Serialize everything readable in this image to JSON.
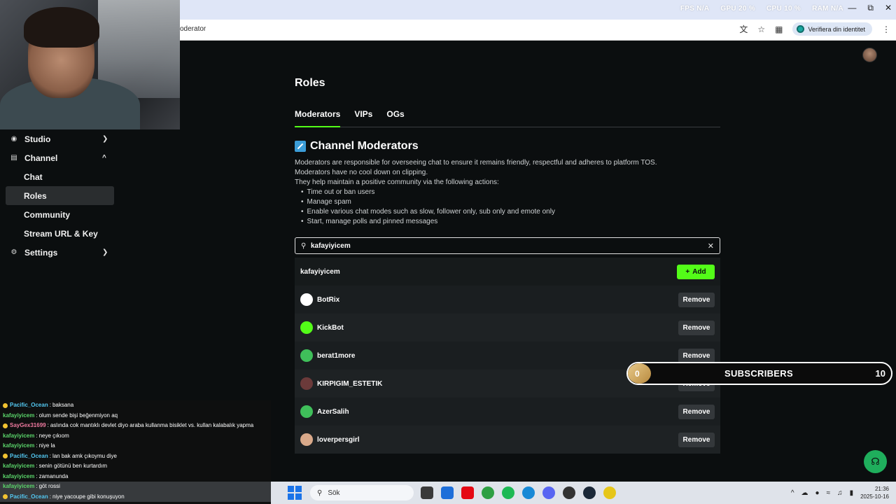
{
  "browser": {
    "url_fragment": "oderator",
    "verify_label": "Verifiera din identitet",
    "overlay_stats": [
      "FPS N/A",
      "GPU 20 %",
      "CPU 10 %",
      "RAM N/A"
    ]
  },
  "sidebar": {
    "studio": "Studio",
    "channel": "Channel",
    "channel_items": [
      "Chat",
      "Roles",
      "Community",
      "Stream URL & Key"
    ],
    "settings": "Settings"
  },
  "page": {
    "title": "Roles",
    "tabs": [
      "Moderators",
      "VIPs",
      "OGs"
    ],
    "section_title": "Channel Moderators",
    "desc_lines": [
      "Moderators are responsible for overseeing chat to ensure it remains friendly, respectful and adheres to platform TOS.",
      "Moderators have no cool down on clipping.",
      "They help maintain a positive community via the following actions:"
    ],
    "bullets": [
      "Time out or ban users",
      "Manage spam",
      "Enable various chat modes such as slow, follower only, sub only and emote only",
      "Start, manage polls and pinned messages"
    ],
    "search_value": "kafayiyicem",
    "search_result": "kafayiyicem",
    "add_label": "Add",
    "remove_label": "Remove",
    "moderators": [
      {
        "name": "BotRix",
        "color": "#ffffff"
      },
      {
        "name": "KickBot",
        "color": "#53fc18"
      },
      {
        "name": "berat1more",
        "color": "#3fbf5a"
      },
      {
        "name": "KIRPIGIM_ESTETIK",
        "color": "#6b3a3a"
      },
      {
        "name": "AzerSalih",
        "color": "#3fbf5a"
      },
      {
        "name": "loverpersgirl",
        "color": "#d9a98a"
      }
    ]
  },
  "subscribers_widget": {
    "progress": "0",
    "label": "SUBSCRIBERS",
    "count": "10"
  },
  "chat": [
    {
      "user": "Pacific_Ocean",
      "text": "baksana",
      "badge": true,
      "color": "#53c7f0"
    },
    {
      "user": "kafayiyicem",
      "text": "olum sende bişi beğenmiyon aq",
      "badge": false,
      "color": "#5bd66b"
    },
    {
      "user": "SayGex31699",
      "text": "aslında cok mantıklı devlet diyo araba kullanma bisiklet vs. kullan kalabalık yapma",
      "badge": true,
      "color": "#f07aa0"
    },
    {
      "user": "kafayiyicem",
      "text": "neye çıkıom",
      "badge": false,
      "color": "#5bd66b"
    },
    {
      "user": "kafayiyicem",
      "text": "niye la",
      "badge": false,
      "color": "#5bd66b"
    },
    {
      "user": "Pacific_Ocean",
      "text": "lan bak amk çıkoymu diye",
      "badge": true,
      "color": "#53c7f0"
    },
    {
      "user": "kafayiyicem",
      "text": "senin götünü ben kurtardım",
      "badge": false,
      "color": "#5bd66b"
    },
    {
      "user": "kafayiyicem",
      "text": "zamanunda",
      "badge": false,
      "color": "#5bd66b"
    },
    {
      "user": "kafayiyicem",
      "text": "göt rossi",
      "badge": false,
      "color": "#5bd66b"
    },
    {
      "user": "Pacific_Ocean",
      "text": "niye yacoupe gibi konuşuyon",
      "badge": true,
      "color": "#53c7f0"
    }
  ],
  "taskbar": {
    "search_label": "Sök",
    "time": "21:36",
    "date": "2025-10-16"
  }
}
